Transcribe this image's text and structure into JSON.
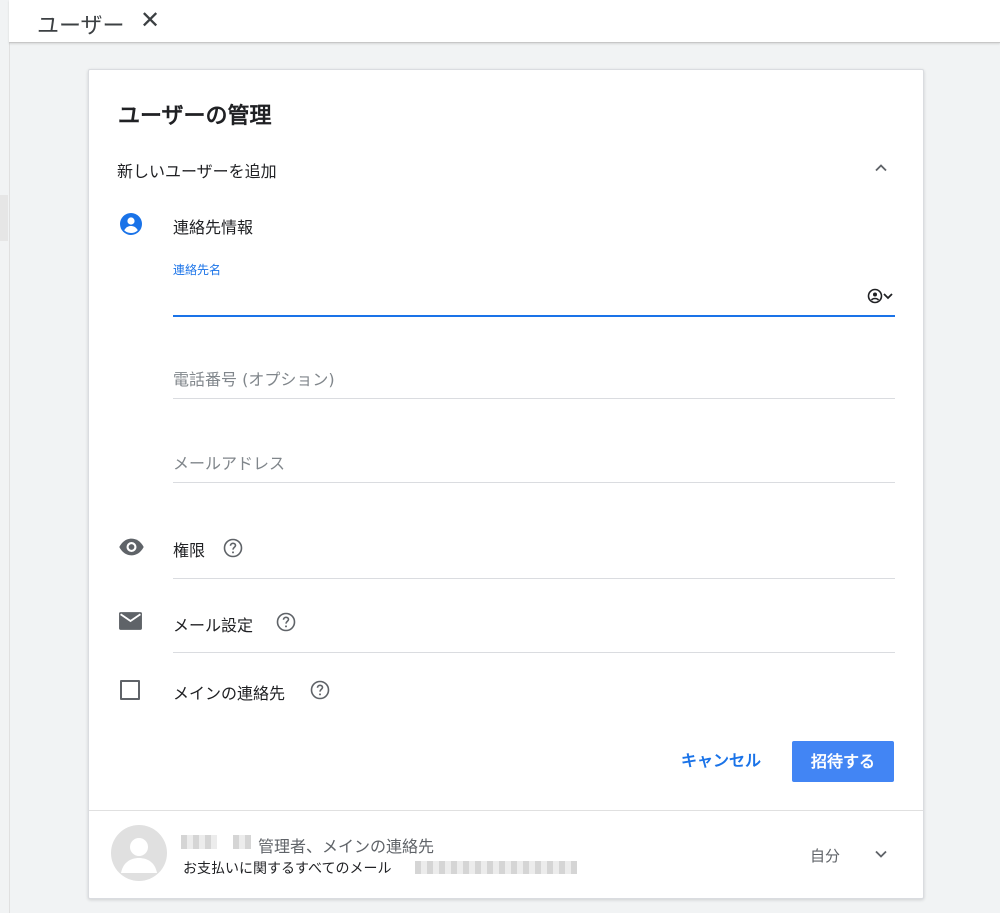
{
  "topbar": {
    "title": "ユーザー",
    "close_glyph": "✕"
  },
  "card": {
    "title": "ユーザーの管理",
    "section_title": "新しいユーザーを追加",
    "contact_info_label": "連絡先情報",
    "fields": {
      "contact_name_label": "連絡先名",
      "contact_name_value": "",
      "phone_placeholder": "電話番号 (オプション)",
      "email_placeholder": "メールアドレス"
    },
    "permissions_label": "権限",
    "email_settings_label": "メール設定",
    "primary_contact_label": "メインの連絡先",
    "primary_contact_checked": false,
    "cancel_label": "キャンセル",
    "invite_label": "招待する"
  },
  "existing_user": {
    "roles": "管理者、メインの連絡先",
    "email_settings": "お支払いに関するすべてのメール",
    "self_label": "自分"
  },
  "icons": {
    "contact": "account-circle-icon",
    "permissions": "eye-icon",
    "email": "envelope-icon",
    "checkbox": "checkbox-icon",
    "help": "help-circle-icon",
    "collapse": "chevron-up-icon",
    "expand": "chevron-down-icon"
  },
  "colors": {
    "accent": "#1a73e8",
    "button": "#4285f4",
    "text": "#202124",
    "muted": "#5f6368"
  }
}
